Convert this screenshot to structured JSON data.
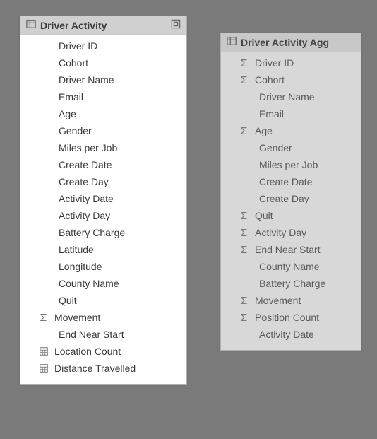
{
  "tables": {
    "driver_activity": {
      "title": "Driver Activity",
      "header_icons": {
        "left": "table-icon",
        "right": "related-icon"
      },
      "active": true,
      "fields": [
        {
          "label": "Driver ID",
          "icon": "",
          "indent": true
        },
        {
          "label": "Cohort",
          "icon": "",
          "indent": true
        },
        {
          "label": "Driver Name",
          "icon": "",
          "indent": true
        },
        {
          "label": "Email",
          "icon": "",
          "indent": true
        },
        {
          "label": "Age",
          "icon": "",
          "indent": true
        },
        {
          "label": "Gender",
          "icon": "",
          "indent": true
        },
        {
          "label": "Miles per Job",
          "icon": "",
          "indent": true
        },
        {
          "label": "Create Date",
          "icon": "",
          "indent": true
        },
        {
          "label": "Create Day",
          "icon": "",
          "indent": true
        },
        {
          "label": "Activity Date",
          "icon": "",
          "indent": true
        },
        {
          "label": "Activity Day",
          "icon": "",
          "indent": true
        },
        {
          "label": "Battery Charge",
          "icon": "",
          "indent": true
        },
        {
          "label": "Latitude",
          "icon": "",
          "indent": true
        },
        {
          "label": "Longitude",
          "icon": "",
          "indent": true
        },
        {
          "label": "County Name",
          "icon": "",
          "indent": true
        },
        {
          "label": "Quit",
          "icon": "",
          "indent": true
        },
        {
          "label": "Movement",
          "icon": "sigma",
          "indent": false
        },
        {
          "label": "End Near Start",
          "icon": "",
          "indent": true
        },
        {
          "label": "Location Count",
          "icon": "measure",
          "indent": false
        },
        {
          "label": "Distance Travelled",
          "icon": "measure",
          "indent": false
        }
      ]
    },
    "driver_activity_agg": {
      "title": "Driver Activity Agg",
      "header_icons": {
        "left": "table-icon",
        "right": ""
      },
      "active": false,
      "fields": [
        {
          "label": "Driver ID",
          "icon": "sigma",
          "indent": false
        },
        {
          "label": "Cohort",
          "icon": "sigma",
          "indent": false
        },
        {
          "label": "Driver Name",
          "icon": "",
          "indent": true
        },
        {
          "label": "Email",
          "icon": "",
          "indent": true
        },
        {
          "label": "Age",
          "icon": "sigma",
          "indent": false
        },
        {
          "label": "Gender",
          "icon": "",
          "indent": true
        },
        {
          "label": "Miles per Job",
          "icon": "",
          "indent": true
        },
        {
          "label": "Create Date",
          "icon": "",
          "indent": true
        },
        {
          "label": "Create Day",
          "icon": "",
          "indent": true
        },
        {
          "label": "Quit",
          "icon": "sigma",
          "indent": false
        },
        {
          "label": "Activity Day",
          "icon": "sigma",
          "indent": false
        },
        {
          "label": "End Near Start",
          "icon": "sigma",
          "indent": false
        },
        {
          "label": "County Name",
          "icon": "",
          "indent": true
        },
        {
          "label": "Battery Charge",
          "icon": "",
          "indent": true
        },
        {
          "label": "Movement",
          "icon": "sigma",
          "indent": false
        },
        {
          "label": "Position Count",
          "icon": "sigma",
          "indent": false
        },
        {
          "label": "Activity Date",
          "icon": "",
          "indent": true
        }
      ]
    }
  }
}
